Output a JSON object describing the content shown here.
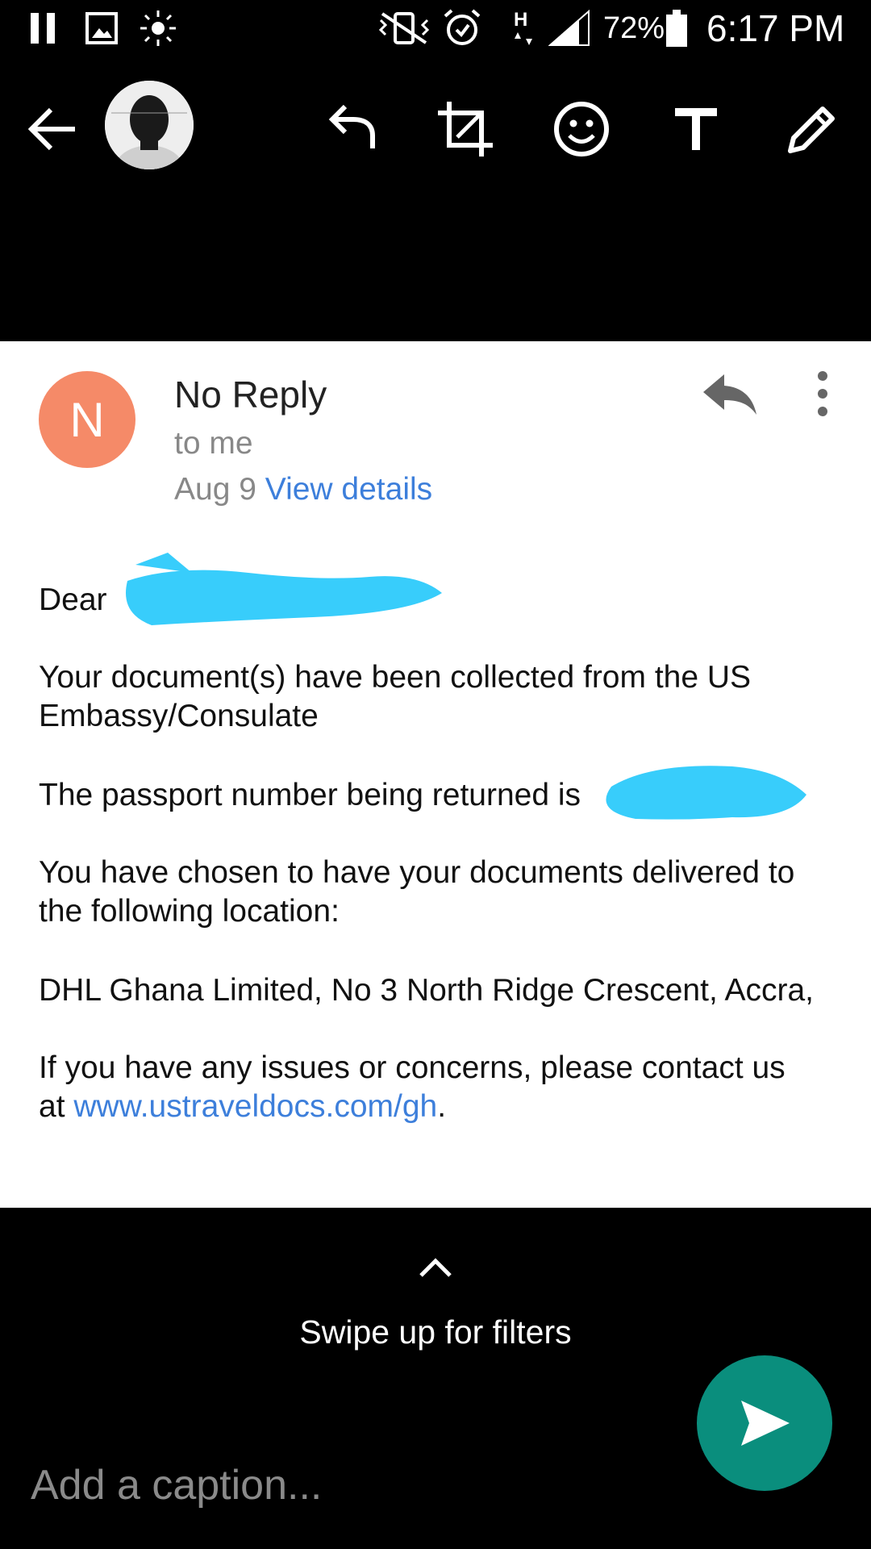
{
  "status_bar": {
    "battery_percent": "72%",
    "time": "6:17 PM",
    "network_type": "H",
    "icons": [
      "pause-icon",
      "image-icon",
      "brightness-icon",
      "vibrate-icon",
      "alarm-icon",
      "network-h-icon",
      "signal-icon",
      "battery-icon"
    ]
  },
  "toolbar": {
    "icons": [
      "back-arrow-icon",
      "contact-avatar",
      "undo-icon",
      "crop-rotate-icon",
      "emoji-icon",
      "text-icon",
      "pencil-icon"
    ]
  },
  "email": {
    "avatar_letter": "N",
    "avatar_color": "#f58a68",
    "sender": "No Reply",
    "recipient": "to me",
    "date": "Aug 9",
    "view_details": "View details",
    "greeting": "Dear",
    "line1a": "Your document(s) have been collected from the US",
    "line1b": "Embassy/Consulate",
    "line2": "The passport number being returned is",
    "line3a": "You have chosen to have your documents delivered to",
    "line3b": "the following location:",
    "line4": "DHL Ghana Limited, No 3 North Ridge Crescent, Accra,",
    "line5a": "If you have any issues or concerns, please contact us",
    "line5b_prefix": "at",
    "link": "www.ustraveldocs.com/gh",
    "line5b_suffix": "."
  },
  "bottom": {
    "swipe_hint": "Swipe up for filters",
    "caption_placeholder": "Add a caption...",
    "send_color": "#0a8e7d"
  },
  "colors": {
    "link": "#3d7fdb",
    "redaction": "#38cdfb"
  }
}
